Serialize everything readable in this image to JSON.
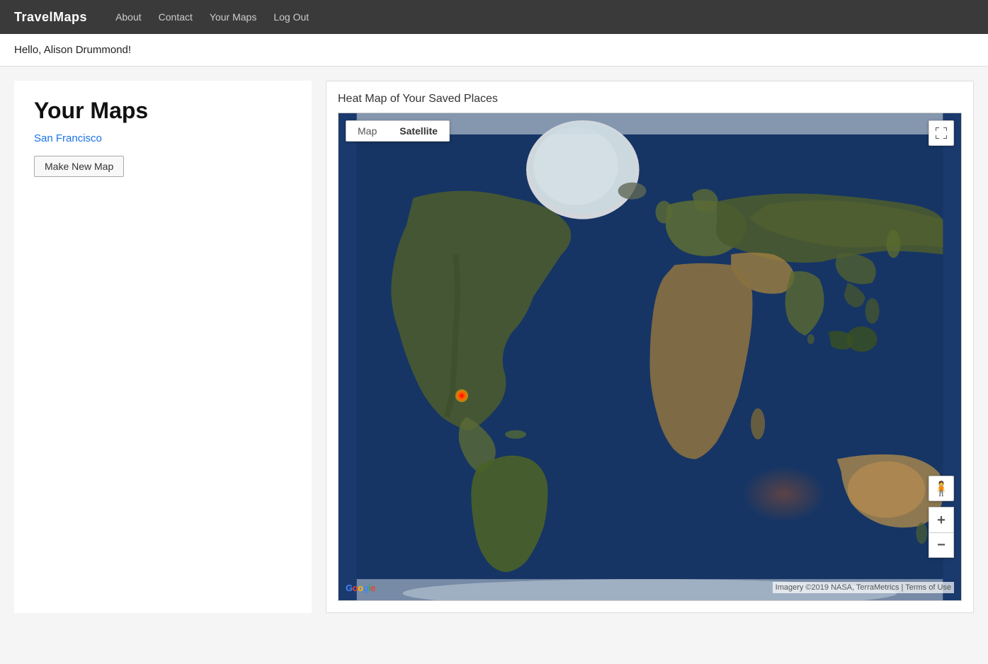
{
  "navbar": {
    "brand": "TravelMaps",
    "links": [
      {
        "label": "About",
        "name": "about-link"
      },
      {
        "label": "Contact",
        "name": "contact-link"
      },
      {
        "label": "Your Maps",
        "name": "your-maps-link"
      },
      {
        "label": "Log Out",
        "name": "logout-link"
      }
    ]
  },
  "greeting": {
    "text": "Hello, Alison Drummond!"
  },
  "left": {
    "title": "Your Maps",
    "saved_maps": [
      {
        "label": "San Francisco",
        "name": "san-francisco-map"
      }
    ],
    "make_new_button": "Make New Map"
  },
  "right": {
    "section_title": "Heat Map of Your Saved Places",
    "map": {
      "tabs": [
        {
          "label": "Map",
          "active": false
        },
        {
          "label": "Satellite",
          "active": true
        }
      ],
      "fullscreen_title": "Toggle fullscreen view",
      "zoom_in_label": "+",
      "zoom_out_label": "−",
      "pegman_label": "🧍",
      "google_logo": "Google",
      "attribution": "Imagery ©2019 NASA, TerraMetrics | Terms of Use"
    }
  }
}
